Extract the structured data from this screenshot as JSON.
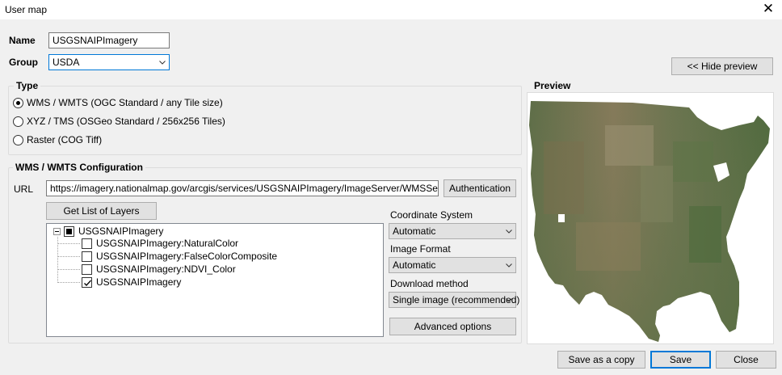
{
  "window": {
    "title": "User map",
    "close_glyph": "✕"
  },
  "form": {
    "name_label": "Name",
    "name_value": "USGSNAIPImagery",
    "group_label": "Group",
    "group_value": "USDA"
  },
  "hide_preview_label": "<< Hide preview",
  "type_group": {
    "title": "Type",
    "options": [
      {
        "label": "WMS / WMTS (OGC Standard / any Tile size)",
        "checked": true
      },
      {
        "label": "XYZ / TMS (OSGeo Standard / 256x256 Tiles)",
        "checked": false
      },
      {
        "label": "Raster (COG Tiff)",
        "checked": false
      }
    ]
  },
  "wms_group": {
    "title": "WMS / WMTS Configuration",
    "url_label": "URL",
    "url_value": "https://imagery.nationalmap.gov/arcgis/services/USGSNAIPImagery/ImageServer/WMSServer?request",
    "authentication_label": "Authentication",
    "get_layers_label": "Get List of Layers",
    "layers": {
      "root": {
        "label": "USGSNAIPImagery",
        "state": "partial"
      },
      "children": [
        {
          "label": "USGSNAIPImagery:NaturalColor",
          "checked": false
        },
        {
          "label": "USGSNAIPImagery:FalseColorComposite",
          "checked": false
        },
        {
          "label": "USGSNAIPImagery:NDVI_Color",
          "checked": false
        },
        {
          "label": "USGSNAIPImagery",
          "checked": true
        }
      ]
    },
    "coordinate_system_label": "Coordinate System",
    "coordinate_system_value": "Automatic",
    "image_format_label": "Image Format",
    "image_format_value": "Automatic",
    "download_method_label": "Download method",
    "download_method_value": "Single image (recommended)",
    "advanced_options_label": "Advanced options"
  },
  "preview": {
    "title": "Preview"
  },
  "footer": {
    "save_copy_label": "Save as a copy",
    "save_label": "Save",
    "close_label": "Close"
  },
  "icons": {
    "close": "close-icon",
    "dropdown": "chevron-down-icon",
    "expander": "tree-collapse-icon"
  }
}
